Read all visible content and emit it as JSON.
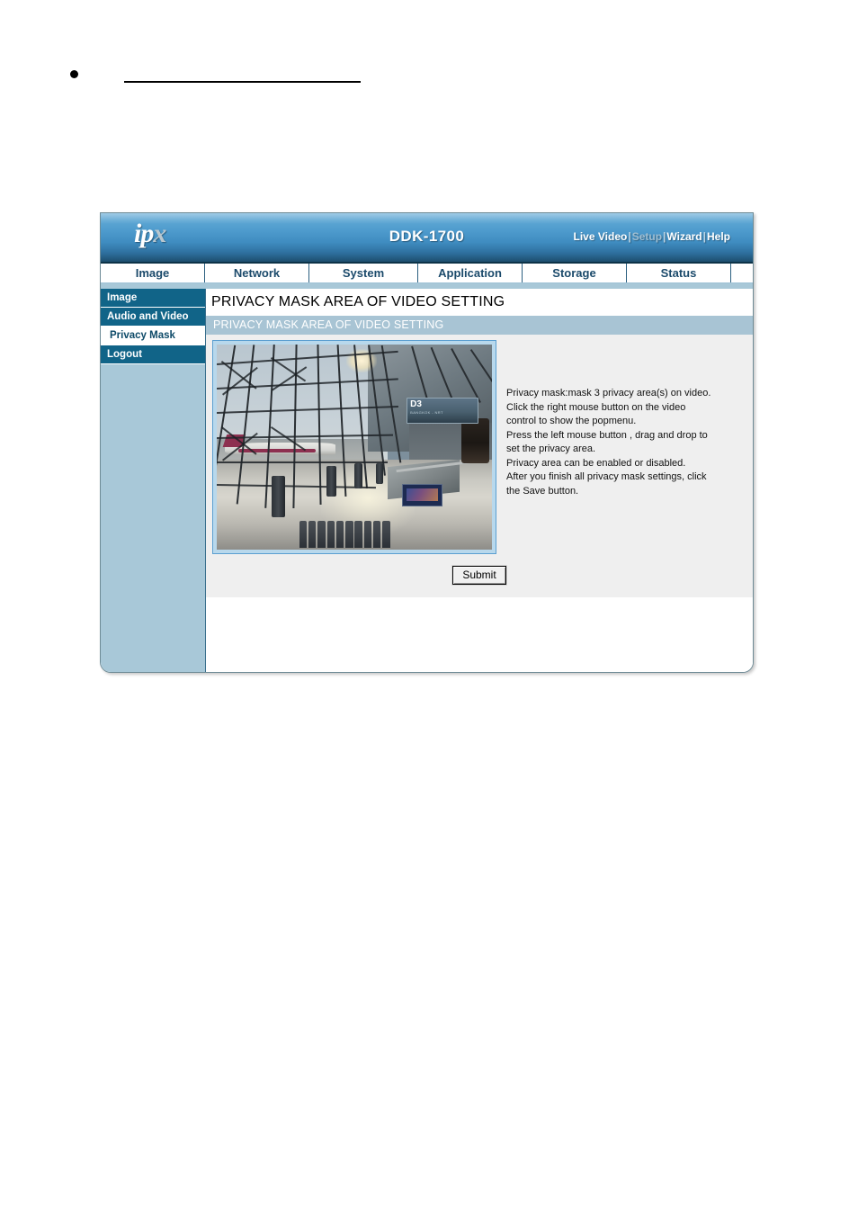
{
  "document": {
    "bullet_heading": ""
  },
  "header": {
    "logo_text": "ip",
    "logo_accent": "x",
    "model_title": "DDK-1700",
    "links": [
      {
        "label": "Live Video",
        "state": "active"
      },
      {
        "label": "Setup",
        "state": "muted"
      },
      {
        "label": "Wizard",
        "state": "active"
      },
      {
        "label": "Help",
        "state": "active"
      }
    ],
    "separator": "|"
  },
  "nav": {
    "tabs": [
      {
        "label": "Image"
      },
      {
        "label": "Network"
      },
      {
        "label": "System"
      },
      {
        "label": "Application"
      },
      {
        "label": "Storage"
      },
      {
        "label": "Status"
      },
      {
        "label": ""
      }
    ]
  },
  "sidebar": {
    "items": [
      {
        "label": "Image",
        "selected": false
      },
      {
        "label": "Audio and Video",
        "selected": false
      },
      {
        "label": "Privacy Mask",
        "selected": true
      },
      {
        "label": "Logout",
        "selected": false
      }
    ]
  },
  "main": {
    "page_title": "PRIVACY MASK AREA OF VIDEO SETTING",
    "section_bar": "PRIVACY MASK AREA OF VIDEO SETTING",
    "video": {
      "overlay_sign": "D3",
      "overlay_sign_sub": "BANGKOK - NRT",
      "alt": "Live video preview of airport terminal"
    },
    "instructions": "Privacy mask:mask 3 privacy area(s) on video.\nClick the right mouse button on the video\ncontrol to show the popmenu.\nPress the left mouse button , drag and drop to\nset the privacy area.\nPrivacy area can be enabled or disabled.\nAfter you finish all privacy mask settings, click\nthe Save button.",
    "submit_label": "Submit"
  },
  "colors": {
    "header_top": "#7ab6dc",
    "header_bottom": "#1d4e6e",
    "sidebar_bg": "#a8c8d8",
    "sidebar_item": "#116488",
    "section_bar": "#a8c4d4",
    "panel_bg": "#efefef",
    "tab_text": "#1b4a6b",
    "video_frame": "#b8d8ec"
  }
}
